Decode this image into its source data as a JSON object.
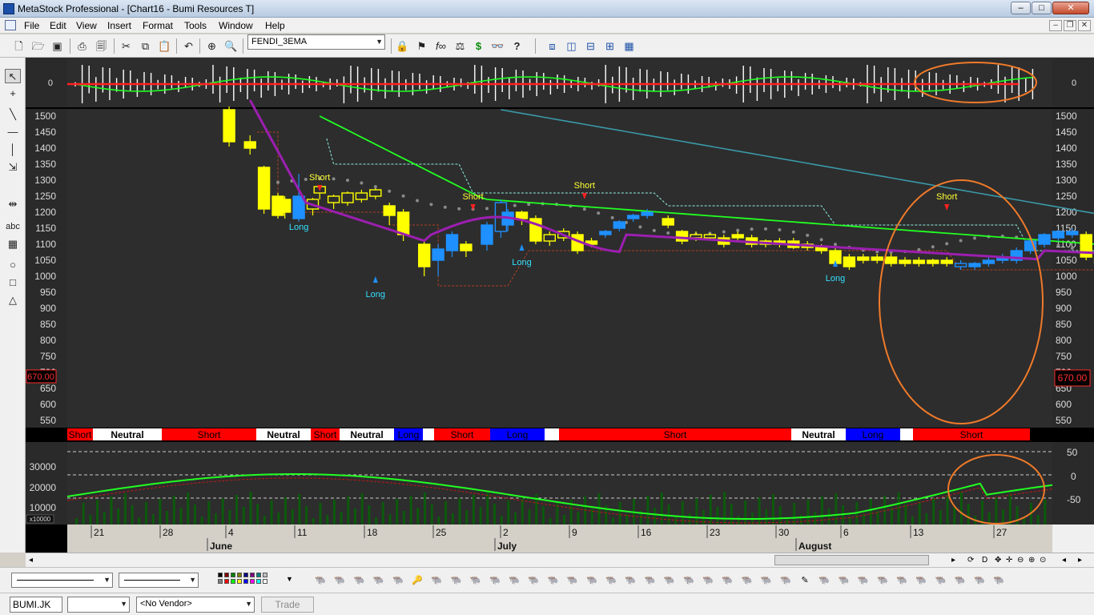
{
  "window": {
    "title": "MetaStock Professional - [Chart16 - Bumi Resources T]",
    "minimize": "–",
    "maximize": "□",
    "close": "✕"
  },
  "menu": {
    "items": [
      "File",
      "Edit",
      "View",
      "Insert",
      "Format",
      "Tools",
      "Window",
      "Help"
    ],
    "mdi_minimize": "–",
    "mdi_restore": "❐",
    "mdi_close": "✕"
  },
  "toolbar": {
    "expert_combo": "FENDI_3EMA",
    "dollar_icon": "$",
    "help_icon": "?"
  },
  "left_tools": {
    "text_tool": "abc"
  },
  "chart": {
    "current_price_label": "670.00",
    "price_axis_ticks": [
      "1500",
      "1450",
      "1400",
      "1350",
      "1300",
      "1250",
      "1200",
      "1150",
      "1100",
      "1050",
      "1000",
      "950",
      "900",
      "850",
      "800",
      "750",
      "700",
      "650",
      "600",
      "550"
    ],
    "top_panel_zero_label": "0",
    "volume_axis_ticks": [
      "30000",
      "20000",
      "10000"
    ],
    "volume_scale_badge": "x10000",
    "osc_axis_ticks": [
      "50",
      "0",
      "-50"
    ],
    "signals": [
      {
        "label": "Short",
        "type": "short"
      },
      {
        "label": "Long",
        "type": "long"
      },
      {
        "label": "Long",
        "type": "long"
      },
      {
        "label": "Short",
        "type": "short"
      },
      {
        "label": "Long",
        "type": "long"
      },
      {
        "label": "Short",
        "type": "short"
      },
      {
        "label": "Long",
        "type": "long"
      },
      {
        "label": "Short",
        "type": "short"
      }
    ],
    "ribbon": [
      {
        "label": "Short",
        "state": "short"
      },
      {
        "label": "Neutral",
        "state": "neutral"
      },
      {
        "label": "Short",
        "state": "short"
      },
      {
        "label": "Neutral",
        "state": "neutral"
      },
      {
        "label": "Short",
        "state": "short"
      },
      {
        "label": "Neutral",
        "state": "neutral"
      },
      {
        "label": "Long",
        "state": "long"
      },
      {
        "label": "",
        "state": "neutral"
      },
      {
        "label": "Short",
        "state": "short"
      },
      {
        "label": "Long",
        "state": "long"
      },
      {
        "label": "",
        "state": "neutral"
      },
      {
        "label": "Short",
        "state": "short"
      },
      {
        "label": "Neutral",
        "state": "neutral"
      },
      {
        "label": "Long",
        "state": "long"
      },
      {
        "label": "",
        "state": "neutral"
      },
      {
        "label": "Short",
        "state": "short"
      }
    ],
    "date_days": [
      "21",
      "28",
      "4",
      "11",
      "18",
      "25",
      "2",
      "9",
      "16",
      "23",
      "30",
      "6",
      "13",
      "27"
    ],
    "date_months": [
      "June",
      "July",
      "August"
    ]
  },
  "bottom": {
    "symbol": "BUMI.JK",
    "vendor": "<No Vendor>",
    "trade_button": "Trade"
  },
  "colors": {
    "short": "#ff0000",
    "long": "#0000ff",
    "neutral": "#ffffff",
    "candle_up": "#1e90ff",
    "candle_down": "#ffff00",
    "ema_fast": "#9c1fb0",
    "ema_mid": "#22ff22",
    "ema_slow": "#3a98a8",
    "annotation": "#f07a2a"
  }
}
